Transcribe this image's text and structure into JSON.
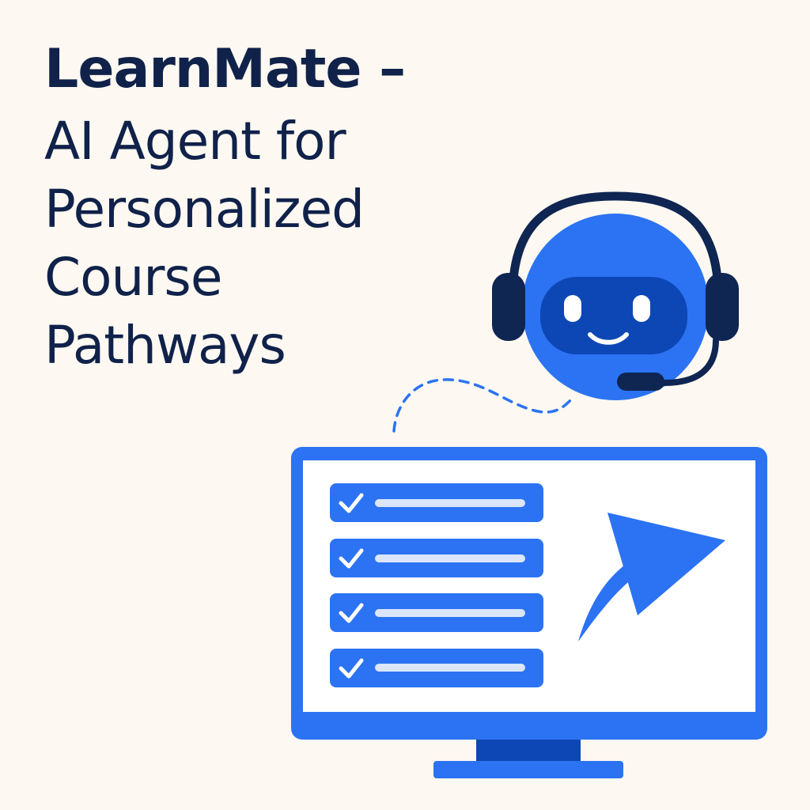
{
  "headline": {
    "line_1": "LearnMate –",
    "line_2": "AI Agent for",
    "line_3": "Personalized",
    "line_4": "Course",
    "line_5": "Pathways"
  },
  "colors": {
    "background": "#fdf8f1",
    "text": "#10224a",
    "brand_blue": "#2b73f2",
    "dark_blue": "#0d47b5",
    "navy": "#0f2552",
    "screen": "#ffffff",
    "row_line": "#dbe6fb"
  },
  "icons": {
    "robot": "robot-head-icon",
    "headset": "headset-icon",
    "monitor": "monitor-icon",
    "check": "checkmark-icon",
    "arrow": "curved-arrow-icon"
  },
  "checklist": {
    "row_count": 4
  }
}
